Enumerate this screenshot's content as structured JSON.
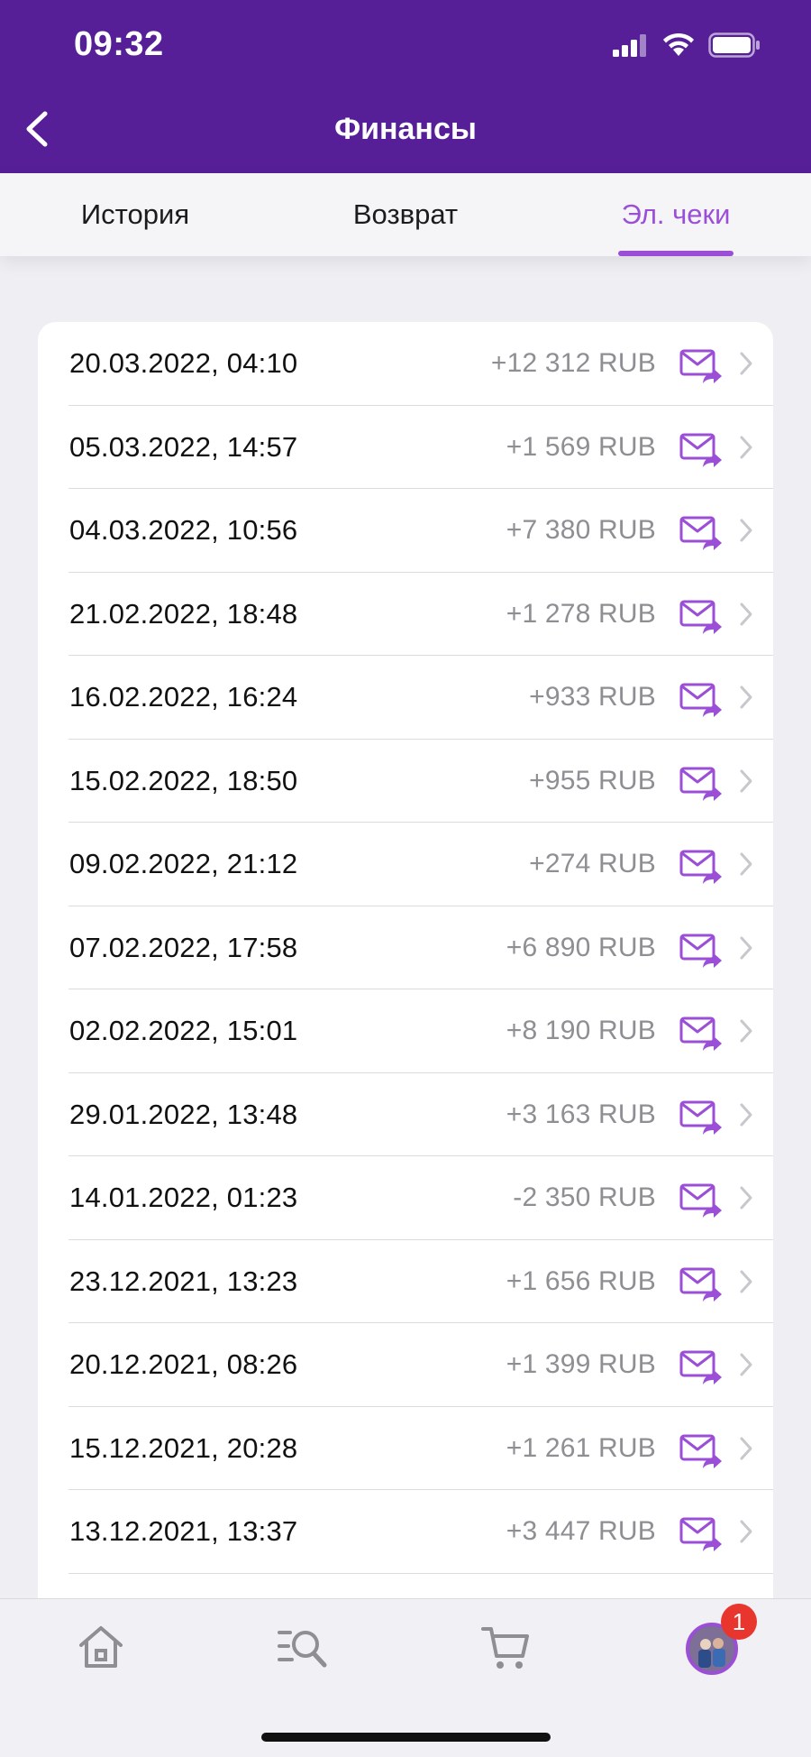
{
  "status_bar": {
    "time": "09:32"
  },
  "nav": {
    "title": "Финансы"
  },
  "tabs": [
    {
      "label": "История",
      "active": false
    },
    {
      "label": "Возврат",
      "active": false
    },
    {
      "label": "Эл. чеки",
      "active": true
    }
  ],
  "receipts": [
    {
      "date": "20.03.2022, 04:10",
      "amount": "+12 312 RUB"
    },
    {
      "date": "05.03.2022, 14:57",
      "amount": "+1 569 RUB"
    },
    {
      "date": "04.03.2022, 10:56",
      "amount": "+7 380 RUB"
    },
    {
      "date": "21.02.2022, 18:48",
      "amount": "+1 278 RUB"
    },
    {
      "date": "16.02.2022, 16:24",
      "amount": "+933 RUB"
    },
    {
      "date": "15.02.2022, 18:50",
      "amount": "+955 RUB"
    },
    {
      "date": "09.02.2022, 21:12",
      "amount": "+274 RUB"
    },
    {
      "date": "07.02.2022, 17:58",
      "amount": "+6 890 RUB"
    },
    {
      "date": "02.02.2022, 15:01",
      "amount": "+8 190 RUB"
    },
    {
      "date": "29.01.2022, 13:48",
      "amount": "+3 163 RUB"
    },
    {
      "date": "14.01.2022, 01:23",
      "amount": "-2 350 RUB"
    },
    {
      "date": "23.12.2021, 13:23",
      "amount": "+1 656 RUB"
    },
    {
      "date": "20.12.2021, 08:26",
      "amount": "+1 399 RUB"
    },
    {
      "date": "15.12.2021, 20:28",
      "amount": "+1 261 RUB"
    },
    {
      "date": "13.12.2021, 13:37",
      "amount": "+3 447 RUB"
    }
  ],
  "row_icons": {
    "send": "mail-send-icon",
    "open": "chevron-right-icon"
  },
  "tab_bar": {
    "items": [
      {
        "icon": "home-icon"
      },
      {
        "icon": "search-catalog-icon"
      },
      {
        "icon": "cart-icon"
      },
      {
        "icon": "profile-avatar"
      }
    ],
    "badge_count": "1"
  },
  "colors": {
    "header": "#561f98",
    "accent": "#9b4fd6",
    "badge": "#e8352e",
    "amount_text": "#8e8e93"
  }
}
